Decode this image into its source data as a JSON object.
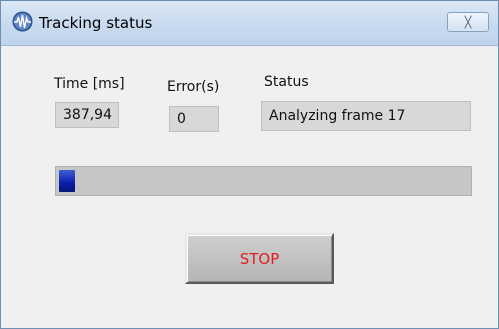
{
  "window": {
    "title": "Tracking status",
    "close_glyph": "╳",
    "icon": "waveform-app-icon"
  },
  "fields": {
    "time": {
      "label": "Time [ms]",
      "value": "387,94"
    },
    "errors": {
      "label": "Error(s)",
      "value": "0"
    },
    "status": {
      "label": "Status",
      "value": "Analyzing frame 17"
    }
  },
  "progress": {
    "fraction": 0.04,
    "color": "#0b1ea8"
  },
  "actions": {
    "stop_label": "STOP",
    "stop_color": "#e02020"
  }
}
